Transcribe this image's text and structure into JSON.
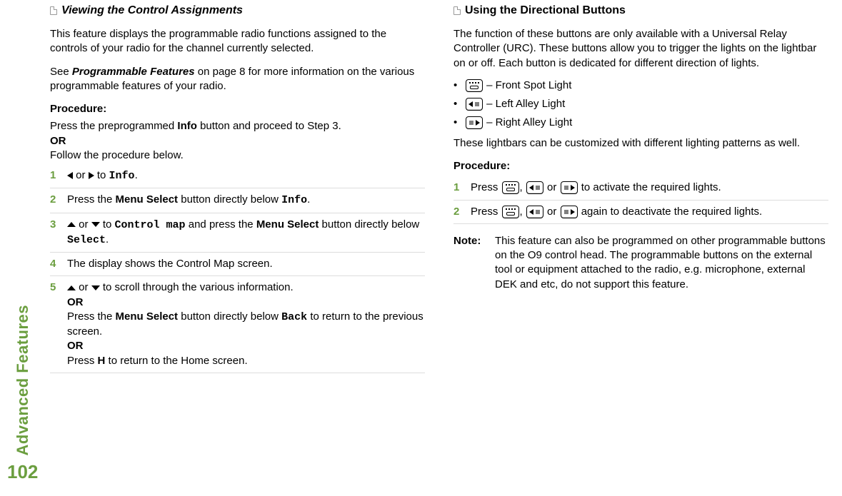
{
  "sidebar": {
    "label": "Advanced Features",
    "page": "102"
  },
  "left": {
    "heading": "Viewing the Control Assignments",
    "intro": "This feature displays the programmable radio functions assigned to the controls of your radio for the channel currently selected.",
    "see_pre": "See ",
    "see_bold": "Programmable Features",
    "see_post": " on page 8 for more information on the various programmable features of your radio.",
    "procedure_label": "Procedure:",
    "proc_line1_pre": "Press the preprogrammed ",
    "proc_line1_bold": "Info",
    "proc_line1_post": " button and proceed to Step 3.",
    "or": "OR",
    "proc_line2": "Follow the procedure below.",
    "steps": {
      "s1": {
        "num": "1",
        "or": " or ",
        "to": " to ",
        "info": "Info",
        "end": "."
      },
      "s2": {
        "num": "2",
        "pre": "Press the ",
        "menu": "Menu Select",
        "mid": " button directly below ",
        "info": "Info",
        "end": "."
      },
      "s3": {
        "num": "3",
        "or": " or ",
        "to": " to ",
        "cmap": "Control map",
        "mid": " and press the ",
        "menu": "Menu Select",
        "mid2": " button directly below ",
        "select": "Select",
        "end": "."
      },
      "s4": {
        "num": "4",
        "text": "The display shows the Control Map screen."
      },
      "s5": {
        "num": "5",
        "line1_or": " or ",
        "line1_post": " to scroll through the various information.",
        "or": "OR",
        "line2_pre": "Press the ",
        "menu": "Menu Select",
        "line2_mid": " button directly below ",
        "back": "Back",
        "line2_post": " to return to the previous screen.",
        "line3_pre": "Press ",
        "home": "H",
        "line3_post": " to return to the Home screen."
      }
    }
  },
  "right": {
    "heading": "Using the Directional Buttons",
    "intro": "The function of these buttons are only available with a Universal Relay Controller (URC). These buttons allow you to trigger the lights on the lightbar on or off. Each button is dedicated for different direction of lights.",
    "bullets": {
      "b1": " – Front Spot Light",
      "b2": " – Left Alley Light",
      "b3": " – Right Alley Light"
    },
    "p2": "These lightbars can be customized with different lighting patterns as well.",
    "procedure_label": "Procedure:",
    "steps": {
      "s1": {
        "num": "1",
        "pre": "Press ",
        "c1": ", ",
        "or": " or ",
        "post": " to activate the required lights."
      },
      "s2": {
        "num": "2",
        "pre": "Press ",
        "c1": ", ",
        "or": " or ",
        "post": " again to deactivate the required lights."
      }
    },
    "note_label": "Note:",
    "note_body": "This feature can also be programmed on other programmable buttons on the O9 control head. The programmable buttons on the external tool or equipment attached to the radio, e.g. microphone, external DEK and etc, do not support this feature."
  }
}
